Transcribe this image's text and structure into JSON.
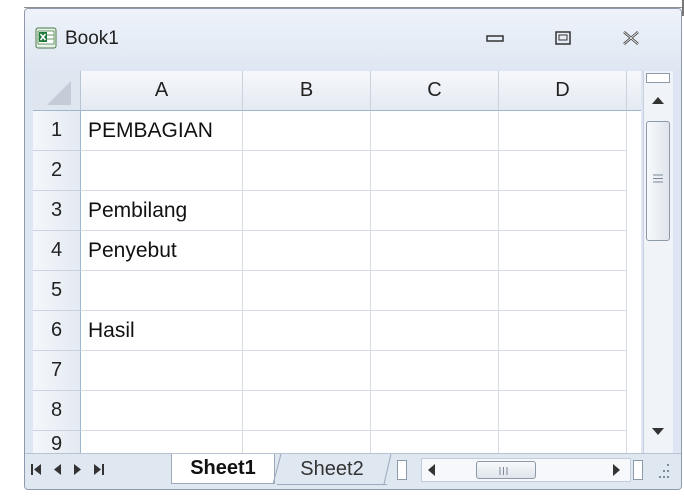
{
  "window": {
    "title": "Book1"
  },
  "columns": [
    "A",
    "B",
    "C",
    "D"
  ],
  "rows": [
    {
      "num": "1",
      "a": "PEMBAGIAN"
    },
    {
      "num": "2",
      "a": ""
    },
    {
      "num": "3",
      "a": "Pembilang"
    },
    {
      "num": "4",
      "a": "Penyebut"
    },
    {
      "num": "5",
      "a": ""
    },
    {
      "num": "6",
      "a": "Hasil"
    },
    {
      "num": "7",
      "a": ""
    },
    {
      "num": "8",
      "a": ""
    },
    {
      "num": "9",
      "a": ""
    }
  ],
  "sheets": {
    "active": "Sheet1",
    "other": "Sheet2"
  },
  "icons": {
    "app": "excel-icon",
    "minimize": "minimize-icon",
    "restore": "restore-icon",
    "close": "close-icon"
  },
  "colors": {
    "accent": "#1f7a3a",
    "header_border": "#9eb6ce"
  }
}
